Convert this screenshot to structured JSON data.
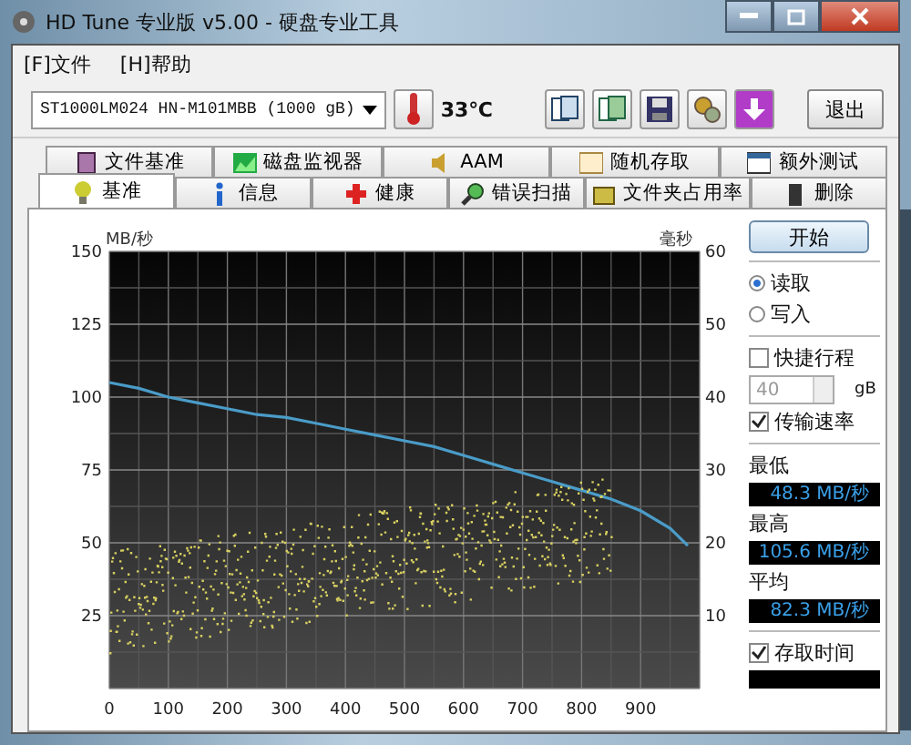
{
  "window": {
    "title": "HD Tune 专业版 v5.00 - 硬盘专业工具"
  },
  "menu": [
    "[F]文件",
    "[H]帮助"
  ],
  "toolbar": {
    "drive": "ST1000LM024 HN-M101MBB  (1000 gB)",
    "temperature": "33℃",
    "exit_button": "退出"
  },
  "tabs_top": [
    {
      "label": "文件基准",
      "selected": false
    },
    {
      "label": "磁盘监视器",
      "selected": false
    },
    {
      "label": "AAM",
      "selected": false
    },
    {
      "label": "随机存取",
      "selected": false
    },
    {
      "label": "额外测试",
      "selected": false
    }
  ],
  "tabs_bottom": [
    {
      "label": "基准",
      "selected": true
    },
    {
      "label": "信息",
      "selected": false
    },
    {
      "label": "健康",
      "selected": false
    },
    {
      "label": "错误扫描",
      "selected": false
    },
    {
      "label": "文件夹占用率",
      "selected": false
    },
    {
      "label": "删除",
      "selected": false
    }
  ],
  "chart": {
    "left_unit": "MB/秒",
    "right_unit": "毫秒",
    "right_ticks": [
      "60",
      "50",
      "40",
      "30",
      "20",
      "10"
    ],
    "chart_data": {
      "type": "line",
      "x": [
        0,
        50,
        100,
        150,
        200,
        250,
        300,
        350,
        400,
        450,
        500,
        550,
        600,
        650,
        700,
        750,
        800,
        850,
        900,
        950,
        980
      ],
      "grid": true,
      "series": [
        {
          "color": "#4a9cc8",
          "values": [
            105,
            103,
            100,
            98,
            96,
            94,
            93,
            91,
            89,
            87,
            85,
            83,
            80,
            77,
            74,
            71,
            68,
            65,
            61,
            55,
            49
          ]
        }
      ],
      "xlim": [
        0,
        1000
      ],
      "ylim": [
        0,
        150
      ],
      "xticks": [
        0,
        100,
        200,
        300,
        400,
        500,
        600,
        700,
        800,
        900
      ],
      "yticks": [
        25,
        50,
        75,
        100,
        125,
        150
      ]
    }
  },
  "panel": {
    "start_button": "开始",
    "modes": [
      {
        "label": "读取",
        "selected": true
      },
      {
        "label": "写入",
        "selected": false
      }
    ],
    "short_stroke": {
      "label": "快捷行程",
      "checked": false,
      "value": "40",
      "disabled": true,
      "unit": "gB"
    },
    "transfer_rate": {
      "label": "传输速率",
      "checked": true
    },
    "stats": [
      {
        "label": "最低",
        "value": "48.3 MB/秒"
      },
      {
        "label": "最高",
        "value": "105.6 MB/秒"
      },
      {
        "label": "平均",
        "value": "82.3 MB/秒"
      }
    ],
    "access_time": {
      "label": "存取时间",
      "checked": true
    }
  }
}
